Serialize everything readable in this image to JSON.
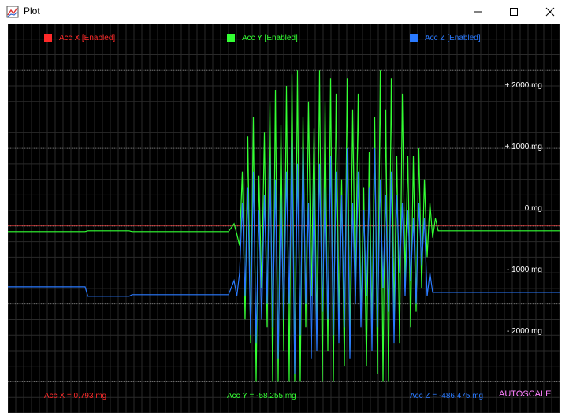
{
  "window": {
    "title": "Plot",
    "minimize_icon": "minimize-icon",
    "maximize_icon": "maximize-icon",
    "close_icon": "close-icon"
  },
  "plot": {
    "background": "#000000",
    "grid_color": "#2a2a2a",
    "legend": [
      {
        "label": "Acc X [Enabled]",
        "color": "#ff2a2a"
      },
      {
        "label": "Acc Y [Enabled]",
        "color": "#33ff33"
      },
      {
        "label": "Acc Z [Enabled]",
        "color": "#2a7aff"
      }
    ],
    "y_labels": [
      "+ 2000 mg",
      "+ 1000 mg",
      "0 mg",
      "- 1000 mg",
      "- 2000 mg"
    ],
    "readouts": {
      "x": "Acc X = 0.793 mg",
      "y": "Acc Y = -58.255 mg",
      "z": "Acc Z = -486.475 mg"
    },
    "autoscale_label": "AUTOSCALE"
  },
  "chart_data": {
    "type": "line",
    "title": "",
    "xlabel": "",
    "ylabel": "",
    "ylim": [
      -2400,
      2600
    ],
    "y_ticks": [
      2000,
      1000,
      0,
      -1000,
      -2000
    ],
    "series": [
      {
        "name": "Acc X [Enabled]",
        "color": "#ff2a2a",
        "x": [
          0,
          100
        ],
        "y": [
          10,
          10
        ]
      },
      {
        "name": "Acc Y [Enabled]",
        "color": "#33ff33",
        "x": [
          0,
          14,
          14.5,
          22,
          22.5,
          40,
          41,
          41.5,
          42,
          42.5,
          43,
          43.5,
          44,
          44.5,
          45,
          45.5,
          46,
          46.5,
          47,
          47.5,
          48,
          48.5,
          49,
          49.5,
          50,
          50.5,
          51,
          51.5,
          52,
          52.5,
          53,
          53.5,
          54,
          54.5,
          55,
          55.5,
          56,
          56.5,
          57,
          57.5,
          58,
          58.5,
          59,
          59.5,
          60,
          60.5,
          61,
          61.5,
          62,
          62.5,
          63,
          63.5,
          64,
          64.5,
          65,
          65.5,
          66,
          66.5,
          67,
          67.5,
          68,
          68.5,
          69,
          69.5,
          70,
          70.5,
          71,
          71.5,
          72,
          72.5,
          73,
          73.5,
          74,
          74.5,
          75,
          75.5,
          76,
          76.5,
          77,
          77.5,
          78,
          100
        ],
        "y": [
          -70,
          -70,
          -60,
          -60,
          -70,
          -70,
          30,
          -100,
          -250,
          700,
          -1200,
          1150,
          -1500,
          1400,
          -2000,
          650,
          -800,
          1200,
          -1300,
          1600,
          -2000,
          1750,
          -2000,
          1300,
          -1600,
          1800,
          -2000,
          1950,
          -2000,
          2000,
          -2000,
          1400,
          -1300,
          1600,
          -900,
          1250,
          -1400,
          2000,
          -2000,
          1600,
          -1600,
          1900,
          -2000,
          1700,
          -1200,
          600,
          -1800,
          1900,
          -1600,
          1500,
          -900,
          1700,
          -1200,
          500,
          -1800,
          950,
          -1300,
          1400,
          -1900,
          2000,
          -2000,
          1500,
          -2000,
          1900,
          -1200,
          900,
          -1500,
          1700,
          -700,
          900,
          -1300,
          900,
          -1100,
          1000,
          -800,
          600,
          -400,
          300,
          -150,
          100,
          -60,
          -60
        ]
      },
      {
        "name": "Acc Z [Enabled]",
        "color": "#2a7aff",
        "x": [
          0,
          14,
          14.5,
          22,
          22.5,
          40,
          41,
          41.5,
          42,
          42.5,
          43,
          43.5,
          44,
          44.5,
          45,
          45.5,
          46,
          46.5,
          47,
          47.5,
          48,
          48.5,
          49,
          49.5,
          50,
          50.5,
          51,
          51.5,
          52,
          52.5,
          53,
          53.5,
          54,
          54.5,
          55,
          55.5,
          56,
          56.5,
          57,
          57.5,
          58,
          58.5,
          59,
          59.5,
          60,
          60.5,
          61,
          61.5,
          62,
          62.5,
          63,
          63.5,
          64,
          64.5,
          65,
          65.5,
          66,
          66.5,
          67,
          67.5,
          68,
          68.5,
          69,
          69.5,
          70,
          70.5,
          71,
          71.5,
          72,
          72.5,
          73,
          73.5,
          74,
          74.5,
          75,
          75.5,
          76,
          76.5,
          77,
          77.5,
          78,
          100
        ],
        "y": [
          -780,
          -780,
          -900,
          -900,
          -880,
          -880,
          -700,
          -900,
          -600,
          300,
          -900,
          500,
          -1400,
          700,
          -1500,
          200,
          -1200,
          400,
          -1000,
          900,
          -1300,
          600,
          -1700,
          400,
          -1200,
          700,
          -1000,
          1100,
          -1900,
          800,
          -1400,
          1000,
          -1000,
          300,
          -1700,
          600,
          -1600,
          800,
          -1100,
          500,
          -1200,
          900,
          -1400,
          700,
          -1500,
          400,
          -1300,
          1000,
          -1700,
          300,
          -1000,
          700,
          -1300,
          200,
          -900,
          500,
          -1600,
          1000,
          -1300,
          600,
          -800,
          400,
          -1100,
          700,
          -1500,
          400,
          -600,
          300,
          -900,
          200,
          -700,
          100,
          -1000,
          300,
          -500,
          100,
          -900,
          -600,
          -850,
          -850,
          -850,
          -850
        ]
      }
    ]
  }
}
